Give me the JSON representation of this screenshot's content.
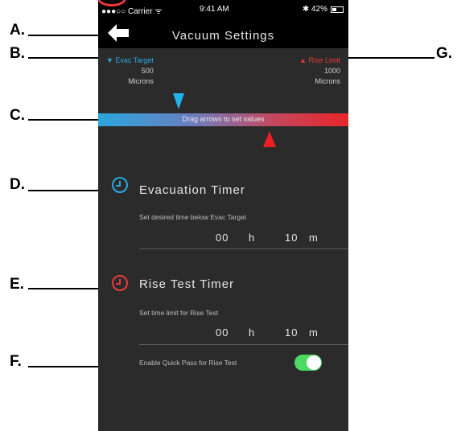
{
  "callouts": {
    "a": "A.",
    "b": "B.",
    "c": "C.",
    "d": "D.",
    "e": "E.",
    "f": "F.",
    "g": "G."
  },
  "status_bar": {
    "carrier": "●●●○○ Carrier ᯤ",
    "time": "9:41 AM",
    "battery": "✱ 42%"
  },
  "nav": {
    "title": "Vacuum Settings"
  },
  "evac_target": {
    "name": "▼ Evac Target",
    "value": "500",
    "unit": "Microns"
  },
  "rise_limit": {
    "name": "▲ Rise Limit",
    "value": "1000",
    "unit": "Microns"
  },
  "slider": {
    "hint": "Drag arrows to set values"
  },
  "evacuation_timer": {
    "title": "Evacuation Timer",
    "description": "Set desired time below Evac Target",
    "hours": "00",
    "hours_unit": "h",
    "minutes": "10",
    "minutes_unit": "m"
  },
  "rise_test_timer": {
    "title": "Rise Test Timer",
    "description": "Set time limit for Rise Test",
    "hours": "00",
    "hours_unit": "h",
    "minutes": "10",
    "minutes_unit": "m"
  },
  "quick_pass": {
    "label": "Enable Quick Pass for Rise Test",
    "enabled": true
  },
  "colors": {
    "evac_blue": "#29a9e1",
    "rise_red": "#e83a3a",
    "toggle_green": "#4cd964",
    "background": "#2b2b2b"
  },
  "icons": {
    "back": "back-arrow-icon",
    "evac_timer": "timer-icon",
    "rise_timer": "timer-icon"
  }
}
